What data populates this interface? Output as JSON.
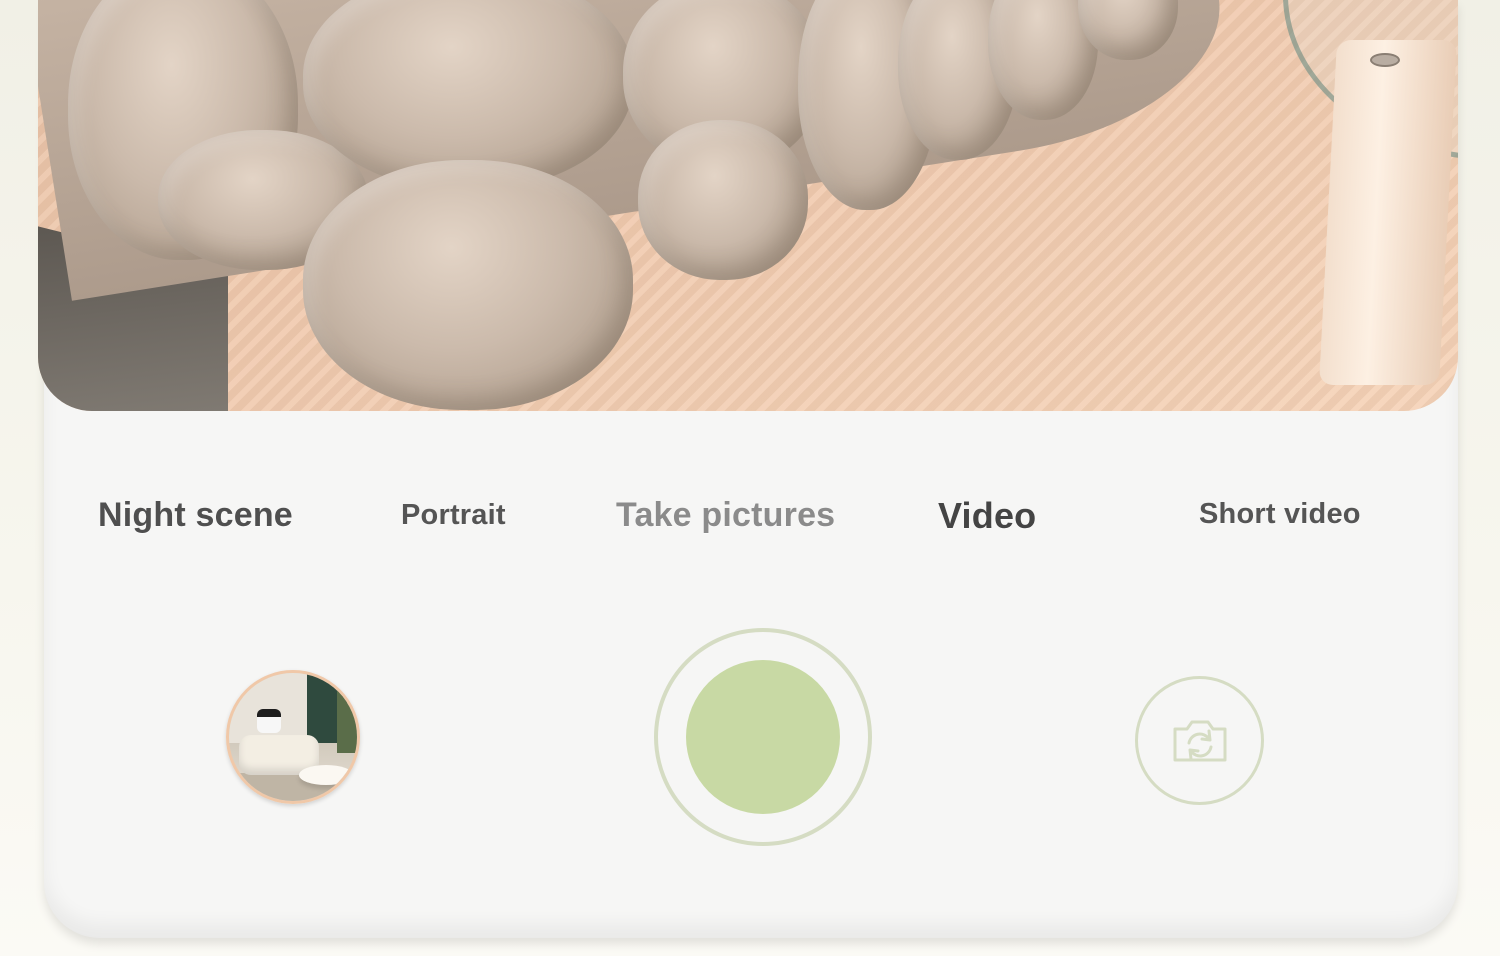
{
  "viewfinder": {
    "description_icon": "camera-preview"
  },
  "modes": [
    {
      "label": "Night scene"
    },
    {
      "label": "Portrait"
    },
    {
      "label": "Take pictures"
    },
    {
      "label": "Video"
    },
    {
      "label": "Short video"
    }
  ],
  "controls": {
    "gallery_icon": "gallery-thumbnail",
    "shutter_icon": "shutter-button",
    "switch_icon": "switch-camera-icon"
  },
  "colors": {
    "accent": "#c8d9a4",
    "ring": "#d5dcc3",
    "thumb_border": "#f0c8a8",
    "panel": "#f6f6f5"
  }
}
